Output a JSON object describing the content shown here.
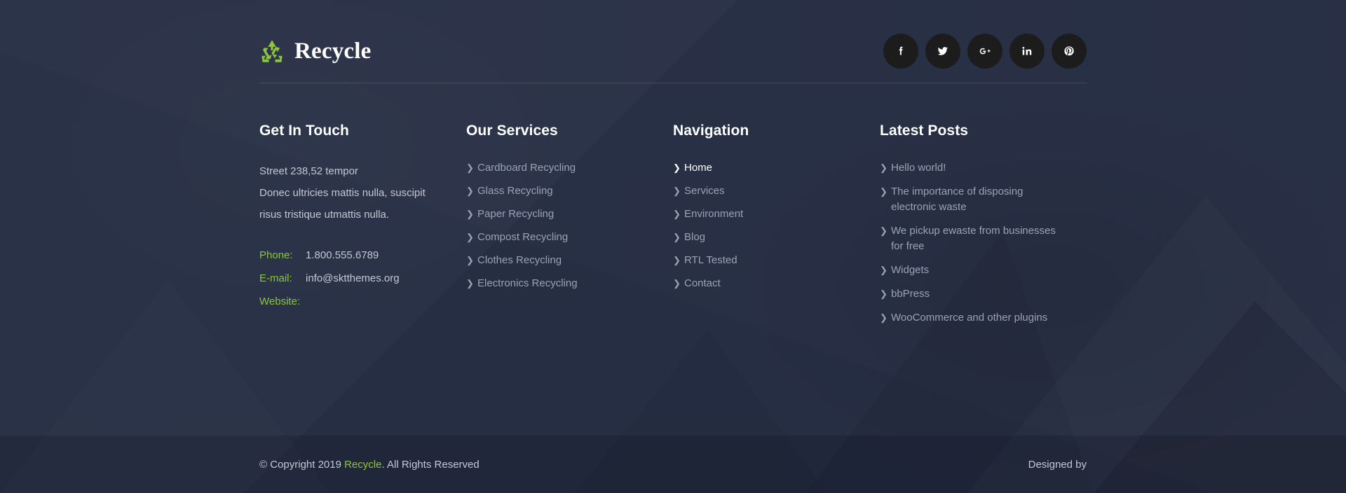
{
  "brand": {
    "name": "Recycle",
    "logo_icon": "recycle-icon",
    "accent_green": "#8cc63e"
  },
  "socials": [
    {
      "name": "facebook",
      "icon": "facebook-icon",
      "label": "f"
    },
    {
      "name": "twitter",
      "icon": "twitter-icon",
      "label": ""
    },
    {
      "name": "google-plus",
      "icon": "google-plus-icon",
      "label": "G+"
    },
    {
      "name": "linkedin",
      "icon": "linkedin-icon",
      "label": "in"
    },
    {
      "name": "pinterest",
      "icon": "pinterest-icon",
      "label": "P"
    }
  ],
  "get_in_touch": {
    "title": "Get In Touch",
    "address": [
      "Street 238,52 tempor",
      "Donec ultricies mattis nulla, suscipit",
      "risus tristique utmattis nulla."
    ],
    "contacts": [
      {
        "label": "Phone:",
        "value": "1.800.555.6789"
      },
      {
        "label": "E-mail:",
        "value": "info@sktthemes.org"
      },
      {
        "label": "Website:",
        "value": ""
      }
    ]
  },
  "our_services": {
    "title": "Our Services",
    "items": [
      "Cardboard Recycling",
      "Glass Recycling",
      "Paper Recycling",
      "Compost Recycling",
      "Clothes Recycling",
      "Electronics Recycling"
    ]
  },
  "navigation": {
    "title": "Navigation",
    "items": [
      {
        "label": "Home",
        "active": true
      },
      {
        "label": "Services",
        "active": false
      },
      {
        "label": "Environment",
        "active": false
      },
      {
        "label": "Blog",
        "active": false
      },
      {
        "label": "RTL Tested",
        "active": false
      },
      {
        "label": "Contact",
        "active": false
      }
    ]
  },
  "latest_posts": {
    "title": "Latest Posts",
    "items": [
      "Hello world!",
      "The importance of disposing electronic waste",
      "We pickup ewaste from businesses for free",
      "Widgets",
      "bbPress",
      "WooCommerce and other plugins"
    ]
  },
  "bottom": {
    "copyright_prefix": "© Copyright 2019 ",
    "copyright_brand": "Recycle",
    "copyright_suffix": ". All Rights Reserved",
    "designed_by": "Designed by"
  },
  "chevron": "❯"
}
